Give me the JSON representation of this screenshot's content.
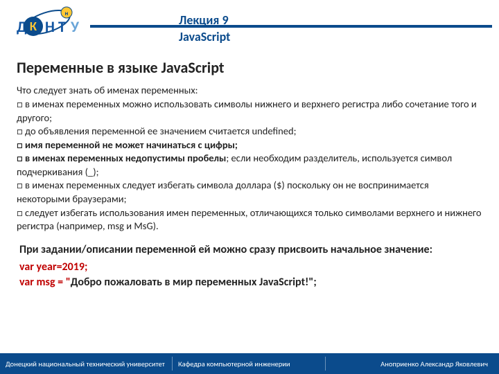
{
  "header": {
    "lecture": "Лекция 9",
    "subject": "JavaScript",
    "logo": {
      "letters": {
        "d": "Д",
        "k": "К",
        "n": "Н",
        "t": "Т",
        "u": "У"
      },
      "orbit_label": "н"
    }
  },
  "title": "Переменные в языке JavaScript",
  "intro": "Что следует знать об именах переменных:",
  "bullets": [
    {
      "bold": false,
      "text": "□ в именах переменных можно использовать символы нижнего и верхнего регистра либо сочетание того и другого;"
    },
    {
      "bold": false,
      "text": "□ до объявления переменной ее значением считается undefined;"
    },
    {
      "bold": true,
      "text": "□ имя переменной не может начинаться с цифры;"
    },
    {
      "bold": true,
      "prefix": "□ в именах переменных недопустимы пробелы",
      "text": "; если необходим разделитель, используется символ подчеркивания (_);"
    },
    {
      "bold": false,
      "text": "□  в именах переменных следует избегать символа доллара ($)  поскольку он не воспринимается  некоторыми браузерами;"
    },
    {
      "bold": false,
      "text": "□  следует  избегать  использования  имен переменных,  отличающихся только символами верхнего и нижнего регистра (например, msg и MsG)."
    }
  ],
  "assign": {
    "title": "При задании/описании переменной ей можно сразу присвоить начальное значение:",
    "code": [
      {
        "pre": "var year=2019;",
        "str": ""
      },
      {
        "pre": "var msg =  \"",
        "str": "Добро пожаловать в мир переменных JavaScript!\";"
      }
    ]
  },
  "footer": {
    "c1": "Донецкий национальный технический университет",
    "c2": "Кафедра компьютерной инженерии",
    "c3": "Аноприенко Александр Яковлевич"
  }
}
